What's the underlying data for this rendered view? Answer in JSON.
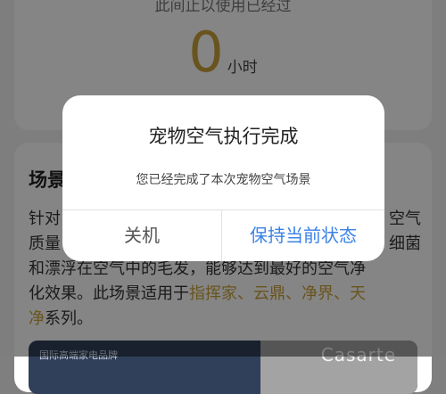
{
  "top_card": {
    "subtitle": "此间止以使用已经过",
    "hours_value": "0",
    "hours_unit": "小时"
  },
  "main_card": {
    "title": "场景",
    "description_part1": "针对",
    "description_tail1": "空气",
    "description_line2_a": "质量",
    "description_line2_b": "细菌",
    "description_line3": "和漂浮在空气中的毛发，能够达到最好的空气净",
    "description_line4_a": "化效果。此场景适用于",
    "highlight_models": "指挥家、云鼎、净界、天",
    "highlight_models_2": "净",
    "description_end": "系列。",
    "highlight_color": "#caa13a"
  },
  "banner": {
    "left_text": "国际高端家电品牌",
    "brand": "Casarte"
  },
  "dialog": {
    "title": "宠物空气执行完成",
    "message": "您已经完成了本次宠物空气场景",
    "button_off": "关机",
    "button_keep": "保持当前状态",
    "button_keep_color": "#3b82e6"
  }
}
